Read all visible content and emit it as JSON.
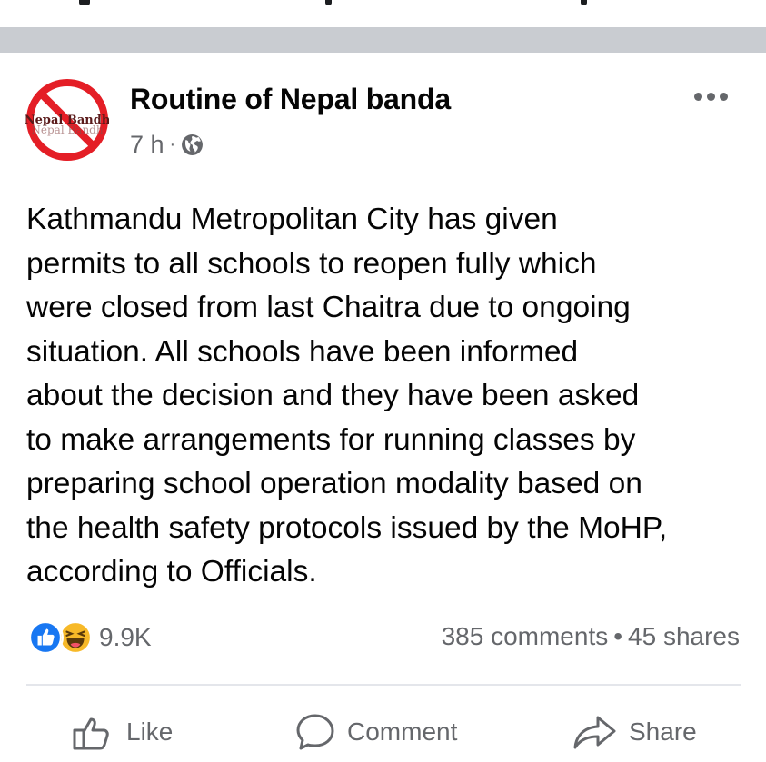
{
  "post": {
    "author": "Routine of Nepal banda",
    "avatar_text": "Nepal Bandh",
    "time": "7 h",
    "separator": "·",
    "visibility_icon": "globe-icon",
    "menu_icon": "more-horizontal-icon",
    "text": "Kathmandu Metropolitan City has given\npermits to all schools to reopen fully which\nwere closed from last Chaitra due to ongoing\nsituation. All schools have been informed\nabout the decision and they have been asked\nto make arrangements for running classes by\npreparing school operation modality based on\nthe health safety protocols issued by the MoHP,\naccording to Officials."
  },
  "engagement": {
    "reaction_icons": [
      "like-reaction-icon",
      "haha-reaction-icon"
    ],
    "reaction_count": "9.9K",
    "comments": "385 comments",
    "separator": "•",
    "shares": "45 shares"
  },
  "actions": {
    "like": "Like",
    "comment": "Comment",
    "share": "Share"
  },
  "colors": {
    "divider_band": "#c9ccd1",
    "secondary_text": "#65676b",
    "like_blue": "#1877f2",
    "haha_yellow": "#f7b928",
    "ban_red": "#e41e26"
  }
}
